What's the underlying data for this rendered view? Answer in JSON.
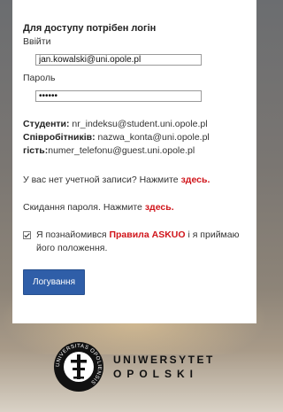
{
  "form": {
    "heading": "Для доступу потрібен логін",
    "login_label": "Ввійти",
    "login_value": "jan.kowalski@uni.opole.pl",
    "password_label": "Пароль",
    "password_value": "••••••"
  },
  "info": {
    "students_label": "Студенти:",
    "students_value": " nr_indeksu@student.uni.opole.pl",
    "staff_label": "Співробітників:",
    "staff_value": " nazwa_konta@uni.opole.pl",
    "guest_label": "гість:",
    "guest_value": "numer_telefonu@guest.uni.opole.pl"
  },
  "no_account": {
    "text": "У вас нет учетной записи? Нажмите ",
    "link": "здесь."
  },
  "reset": {
    "text": "Скидання пароля. Нажмите ",
    "link": "здесь."
  },
  "agree": {
    "text_before": "Я познайомився ",
    "link": "Правила ASKUO",
    "text_after": " і я приймаю його положення."
  },
  "login_button": "Логування",
  "logo": {
    "line1": "UNIWERSYTET",
    "line2": "OPOLSKI",
    "seal_text": "UNIVERSITAS OPOLIENSIS"
  },
  "colors": {
    "accent": "#2f5ea8",
    "link": "#d0141a"
  }
}
